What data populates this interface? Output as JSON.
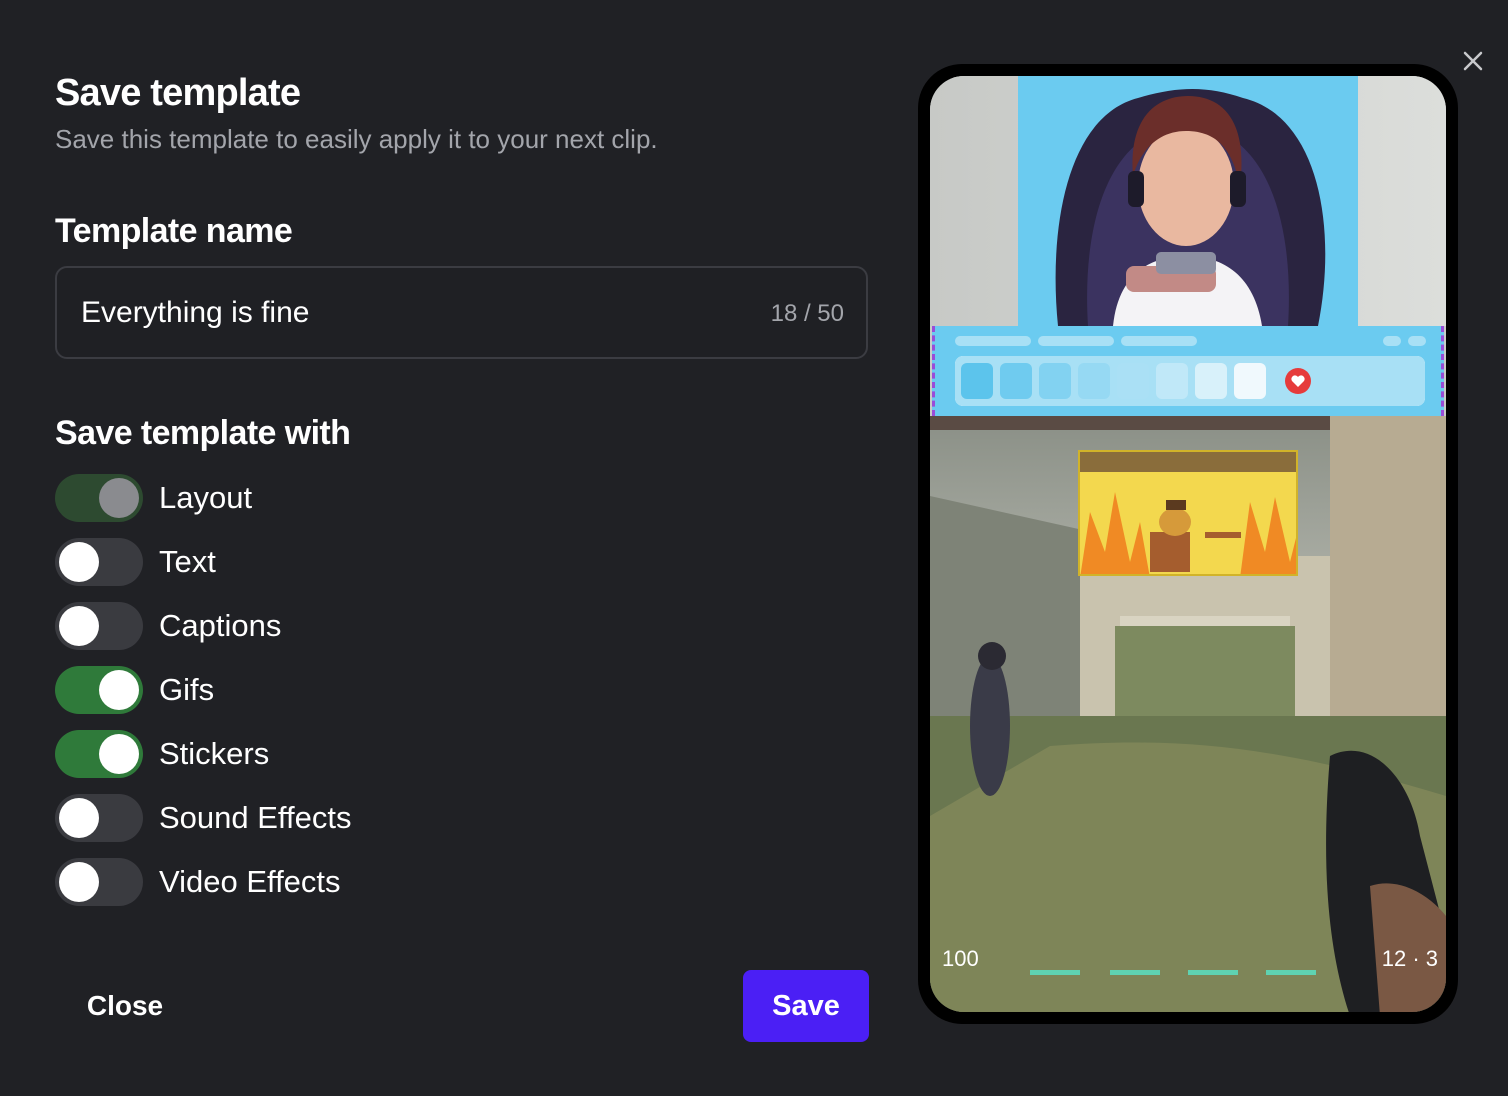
{
  "dialog": {
    "title": "Save template",
    "subtitle": "Save this template to easily apply it to your next clip."
  },
  "name_section": {
    "heading": "Template name",
    "value": "Everything is fine",
    "counter": "18 / 50"
  },
  "options_section": {
    "heading": "Save template with",
    "toggles": [
      {
        "label": "Layout",
        "state": "on",
        "disabled": true
      },
      {
        "label": "Text",
        "state": "off"
      },
      {
        "label": "Captions",
        "state": "off"
      },
      {
        "label": "Gifs",
        "state": "on"
      },
      {
        "label": "Stickers",
        "state": "on"
      },
      {
        "label": "Sound Effects",
        "state": "off"
      },
      {
        "label": "Video Effects",
        "state": "off"
      }
    ]
  },
  "footer": {
    "close_label": "Close",
    "save_label": "Save"
  },
  "preview": {
    "hud_health": "100",
    "hud_ammo": "12 · 3"
  },
  "colors": {
    "background": "#202125",
    "accent": "#4b1ff5",
    "toggle_on": "#2f7a3a",
    "toggle_off": "#3a3b40"
  }
}
